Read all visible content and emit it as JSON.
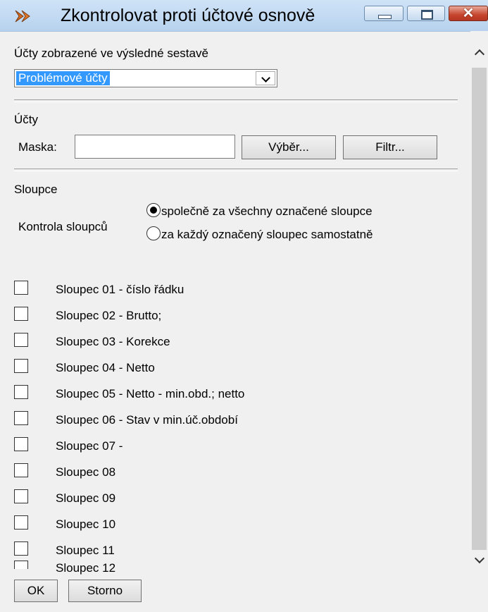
{
  "window": {
    "title": "Zkontrolovat proti účtové osnově",
    "close_glyph": "✕"
  },
  "display_section": {
    "label": "Účty zobrazené ve výsledné sestavě",
    "selected_value": "Problémové účty"
  },
  "accounts_section": {
    "label": "Účty",
    "mask_label": "Maska:",
    "mask_value": "",
    "select_button": "Výběr...",
    "filter_button": "Filtr..."
  },
  "columns_section": {
    "label": "Sloupce",
    "check_label": "Kontrola sloupců",
    "option_together": "společně za všechny označené sloupce",
    "option_separately": "za každý označený sloupec samostatně",
    "selected_option": "together"
  },
  "columns": [
    {
      "label": "Sloupec 01 - číslo řádku",
      "checked": false
    },
    {
      "label": "Sloupec 02 - Brutto;",
      "checked": false
    },
    {
      "label": "Sloupec 03 - Korekce",
      "checked": false
    },
    {
      "label": "Sloupec 04 - Netto",
      "checked": false
    },
    {
      "label": "Sloupec 05 - Netto - min.obd.; netto",
      "checked": false
    },
    {
      "label": "Sloupec 06 - Stav v min.úč.období",
      "checked": false
    },
    {
      "label": "Sloupec 07 -",
      "checked": false
    },
    {
      "label": "Sloupec 08",
      "checked": false
    },
    {
      "label": "Sloupec 09",
      "checked": false
    },
    {
      "label": "Sloupec 10",
      "checked": false
    },
    {
      "label": "Sloupec 11",
      "checked": false
    },
    {
      "label": "Sloupec 12",
      "checked": false
    }
  ],
  "footer": {
    "ok_label": "OK",
    "cancel_label": "Storno"
  }
}
